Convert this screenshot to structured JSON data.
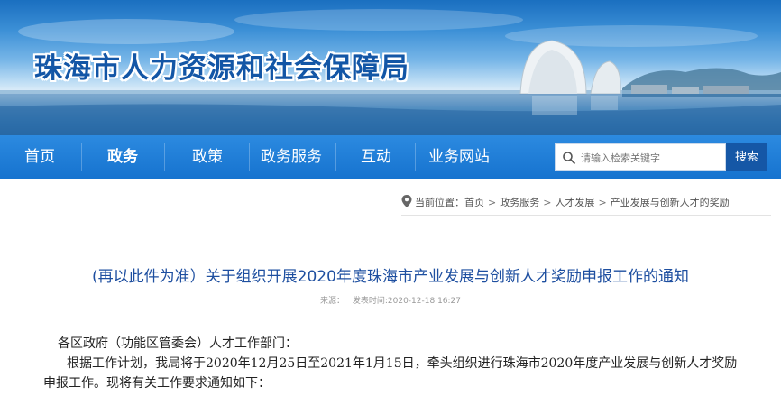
{
  "site": {
    "title": "珠海市人力资源和社会保障局"
  },
  "nav": {
    "items": [
      {
        "label": "首页",
        "active": false
      },
      {
        "label": "政务",
        "active": true
      },
      {
        "label": "政策",
        "active": false
      },
      {
        "label": "政务服务",
        "active": false
      },
      {
        "label": "互动",
        "active": false
      },
      {
        "label": "业务网站",
        "active": false
      }
    ]
  },
  "search": {
    "placeholder": "请输入检索关键字",
    "button_label": "搜索"
  },
  "breadcrumb": {
    "prefix": "当前位置：",
    "items": [
      "首页",
      "政务服务",
      "人才发展",
      "产业发展与创新人才的奖励"
    ],
    "separator": ">"
  },
  "article": {
    "title": "(再以此件为准）关于组织开展2020年度珠海市产业发展与创新人才奖励申报工作的通知",
    "source_label": "来源：",
    "date_label": "发表时间:2020-12-18 16:27",
    "paragraphs": [
      "各区政府（功能区管委会）人才工作部门：",
      "根据工作计划，我局将于2020年12月25日至2021年1月15日，牵头组织进行珠海市2020年度产业发展与创新人才奖励申报工作。现将有关工作要求通知如下："
    ]
  },
  "colors": {
    "nav_bg": "#1673cf",
    "title_blue": "#1356a6",
    "article_title": "#1e4fa0",
    "search_button": "#1557a6"
  }
}
